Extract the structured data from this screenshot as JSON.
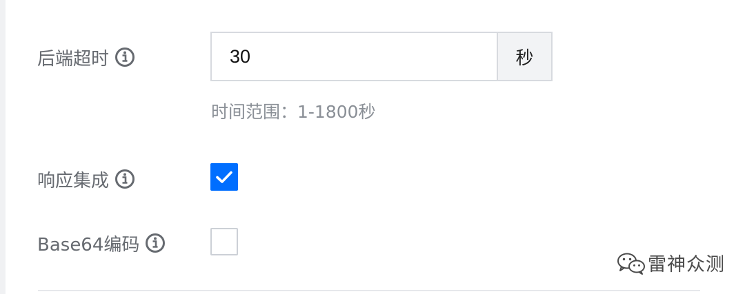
{
  "form": {
    "backend_timeout": {
      "label": "后端超时",
      "value": "30",
      "unit": "秒",
      "hint": "时间范围：1-1800秒"
    },
    "response_integration": {
      "label": "响应集成",
      "checked": true
    },
    "base64_encoding": {
      "label": "Base64编码",
      "checked": false
    }
  },
  "icons": {
    "info": "info-circle-icon",
    "check": "checkmark-icon",
    "watermark": "wechat-icon"
  },
  "watermark": {
    "text": "雷神众测"
  },
  "colors": {
    "accent": "#006eff",
    "label": "#666a70",
    "hint": "#8a8f96",
    "border": "#d7dadf",
    "addon_bg": "#f2f3f5"
  }
}
